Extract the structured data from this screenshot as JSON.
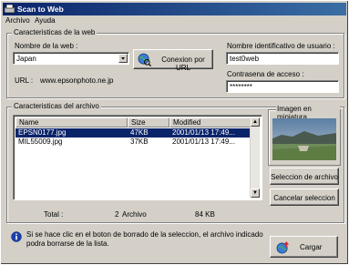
{
  "window": {
    "title": "Scan to Web"
  },
  "menu": {
    "file": "Archivo",
    "help": "Ayuda"
  },
  "web_group": {
    "legend": "Caracteristicas de la web",
    "web_name_label": "Nombre de la web :",
    "web_name_value": "Japan",
    "connect_button": "Conexion por URL",
    "url_label": "URL :",
    "url_value": "www.epsonphoto.ne.jp",
    "user_id_label": "Nombre identificativo de usuario :",
    "user_id_value": "test0web",
    "password_label": "Contrasena de acceso :",
    "password_value": "********"
  },
  "file_group": {
    "legend": "Caracteristicas del archivo",
    "columns": [
      "Name",
      "Size",
      "Modified"
    ],
    "rows": [
      {
        "name": "EPSN0177.jpg",
        "size": "47KB",
        "modified": "2001/01/13 17:49...",
        "selected": true
      },
      {
        "name": "MIL55009.jpg",
        "size": "37KB",
        "modified": "2001/01/13 17:49...",
        "selected": false
      }
    ],
    "thumbnail_label": "Imagen en miniatura",
    "select_file_button": "Seleccion de archivo",
    "cancel_selection_button": "Cancelar seleccion",
    "total_label": "Total :",
    "total_count": "2",
    "total_unit": "Archivo",
    "total_size": "84 KB"
  },
  "info_text": "Si se hace clic en el boton de borrado de la seleccion, el archivo indicado podra borrarse de la lista.",
  "upload_button": "Cargar"
}
